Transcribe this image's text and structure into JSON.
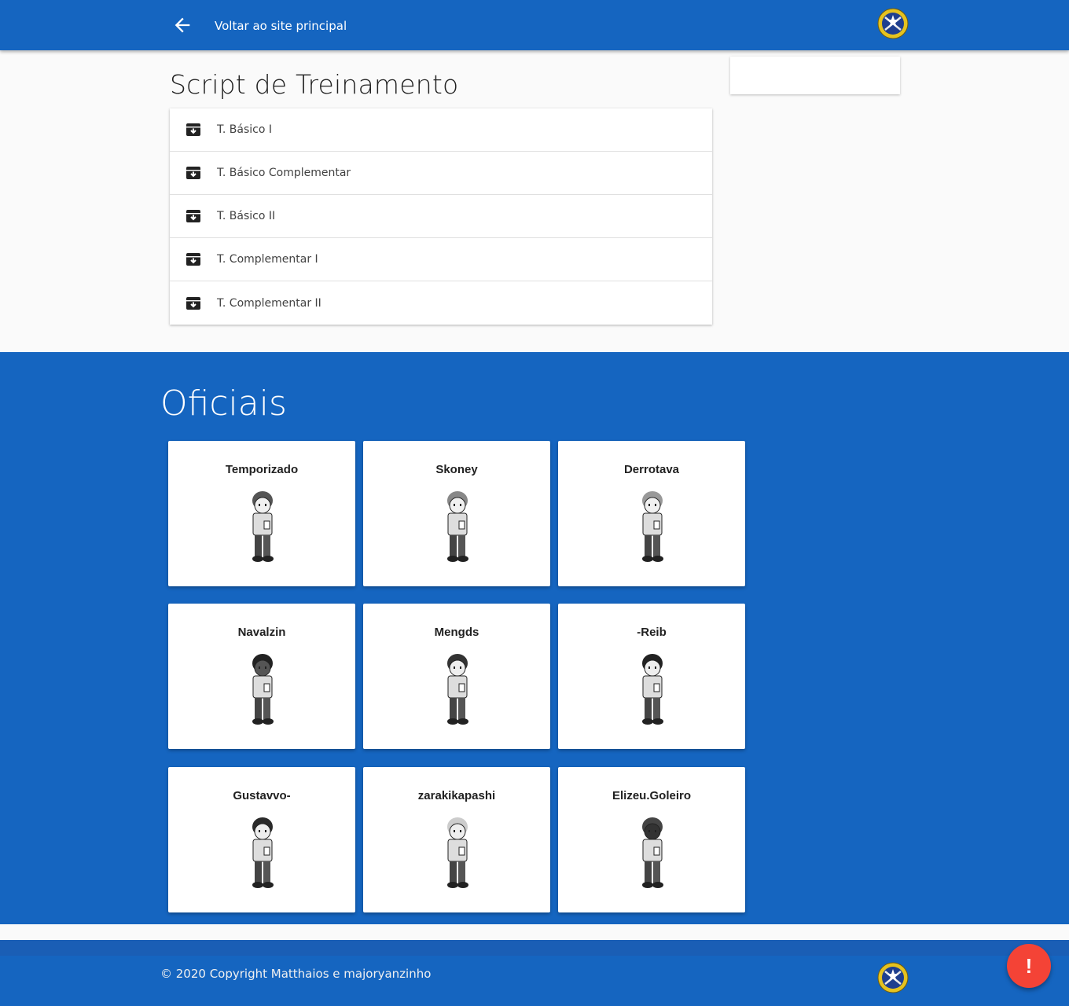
{
  "topbar": {
    "back_label": "Voltar ao site principal",
    "logo_icon": "military-crest-icon",
    "color": "#1565c0"
  },
  "main": {
    "title": "Script de Treinamento",
    "items": [
      {
        "label": "T. Básico I",
        "icon": "archive-download-icon"
      },
      {
        "label": "T. Básico Complementar",
        "icon": "archive-download-icon"
      },
      {
        "label": "T. Básico II",
        "icon": "archive-download-icon"
      },
      {
        "label": "T. Complementar I",
        "icon": "archive-download-icon"
      },
      {
        "label": "T. Complementar II",
        "icon": "archive-download-icon"
      }
    ]
  },
  "officials": {
    "title": "Oficiais",
    "cards": [
      {
        "name": "Temporizado"
      },
      {
        "name": "Skoney"
      },
      {
        "name": "Derrotava"
      },
      {
        "name": "Navalzin"
      },
      {
        "name": "Mengds"
      },
      {
        "name": "-Reib"
      },
      {
        "name": "Gustavvo-"
      },
      {
        "name": "zarakikapashi"
      },
      {
        "name": "Elizeu.Goleiro"
      }
    ]
  },
  "footer": {
    "copyright": "© 2020 Copyright Matthaios e majoryanzinho"
  },
  "fab": {
    "label": "!",
    "color": "#f44336"
  }
}
